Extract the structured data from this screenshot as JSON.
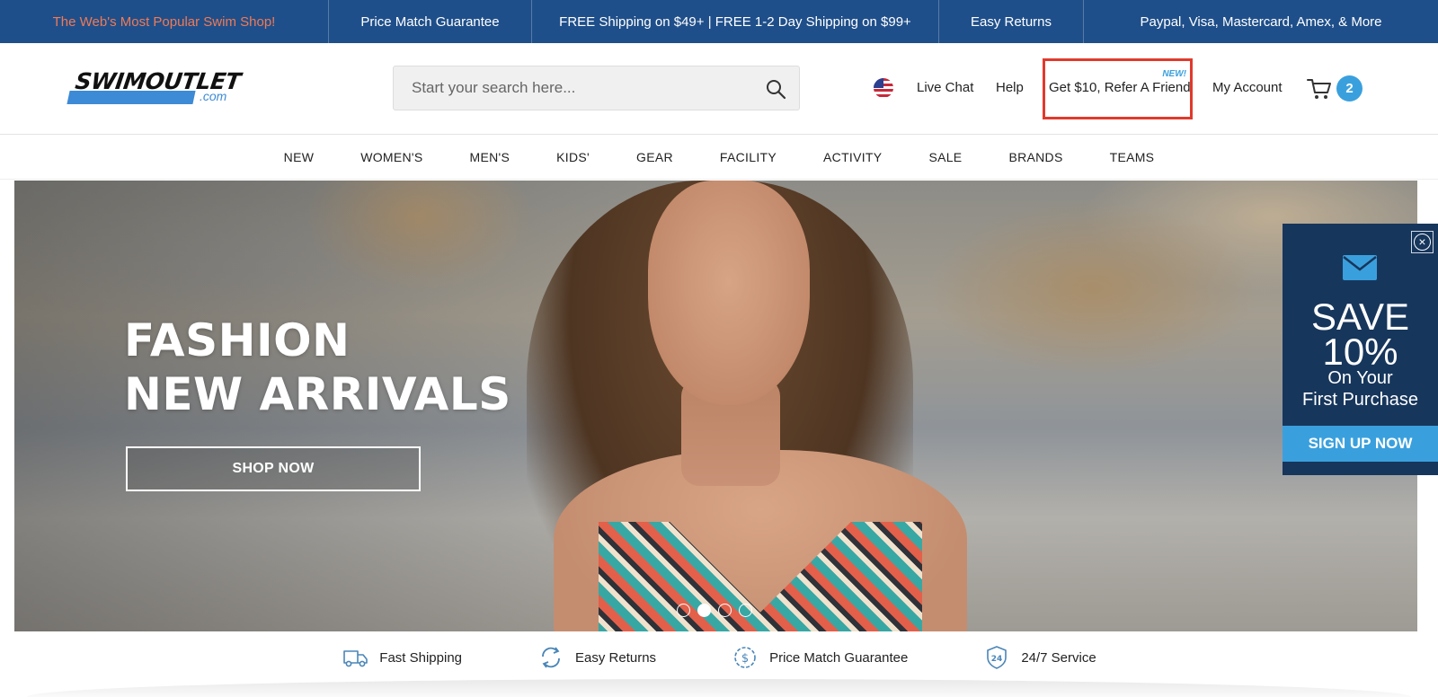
{
  "promo_bar": {
    "items": [
      "The Web's Most Popular Swim Shop!",
      "Price Match Guarantee",
      "FREE Shipping on $49+ | FREE 1-2 Day Shipping on $99+",
      "Easy Returns",
      "Paypal, Visa, Mastercard, Amex, & More"
    ]
  },
  "header": {
    "logo": {
      "word": "SWIMOUTLET",
      "suffix": ".com"
    },
    "search": {
      "placeholder": "Start your search here...",
      "value": ""
    },
    "flag_icon": "us-flag-icon",
    "live_chat": "Live Chat",
    "help": "Help",
    "refer": {
      "badge": "NEW!",
      "label": "Get $10, Refer A Friend"
    },
    "my_account": "My Account",
    "cart_count": "2"
  },
  "nav": {
    "items": [
      "NEW",
      "WOMEN'S",
      "MEN'S",
      "KIDS'",
      "GEAR",
      "FACILITY",
      "ACTIVITY",
      "SALE",
      "BRANDS",
      "TEAMS"
    ]
  },
  "hero": {
    "title_line1": "FASHION",
    "title_line2": "NEW ARRIVALS",
    "cta": "SHOP NOW",
    "slides_total": 4,
    "active_slide": 2
  },
  "popup": {
    "save": "SAVE",
    "percent": "10%",
    "line1": "On Your",
    "line2": "First Purchase",
    "cta": "SIGN UP NOW"
  },
  "features": [
    {
      "icon": "truck-icon",
      "label": "Fast Shipping"
    },
    {
      "icon": "returns-icon",
      "label": "Easy Returns"
    },
    {
      "icon": "dollar-badge-icon",
      "label": "Price Match Guarantee"
    },
    {
      "icon": "24-shield-icon",
      "label": "24/7 Service"
    }
  ],
  "colors": {
    "promo_bg": "#1f4f8a",
    "promo_accent": "#f07a55",
    "brand_blue": "#3aa0dd",
    "popup_bg": "#17365c",
    "highlight_box": "#e03a2c"
  }
}
